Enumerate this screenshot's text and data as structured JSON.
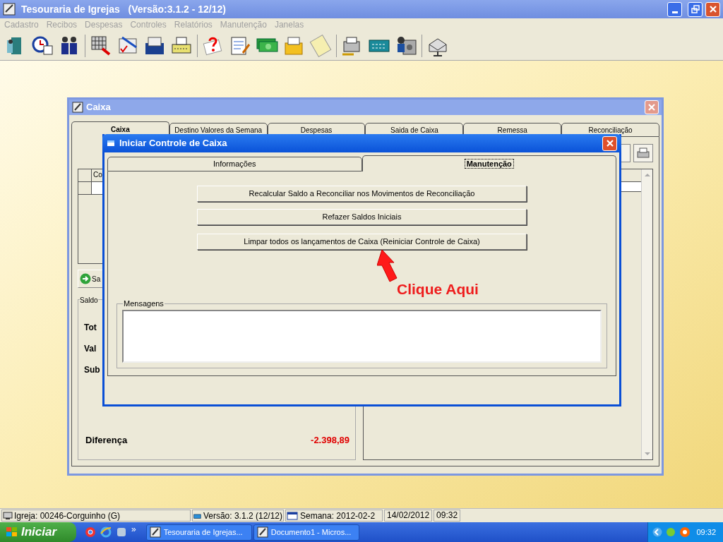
{
  "app_window": {
    "title": "Tesouraria de Igrejas   (Versão:3.1.2 - 12/12)"
  },
  "menu": [
    {
      "label": "Cadastro",
      "disabled": true
    },
    {
      "label": "Recibos",
      "disabled": true
    },
    {
      "label": "Despesas",
      "disabled": true
    },
    {
      "label": "Controles",
      "disabled": true
    },
    {
      "label": "Relatórios",
      "disabled": true
    },
    {
      "label": "Manutenção",
      "disabled": true
    },
    {
      "label": "Janelas",
      "disabled": true
    }
  ],
  "caixa_window": {
    "title": "Caixa",
    "tabs": [
      {
        "label": "Caixa",
        "selected": true
      },
      {
        "label": "Destino Valores da Semana",
        "selected": false
      },
      {
        "label": "Despesas",
        "selected": false
      },
      {
        "label": "Saida de Caixa",
        "selected": false
      },
      {
        "label": "Remessa",
        "selected": false
      },
      {
        "label": "Reconciliação",
        "selected": false
      }
    ],
    "table": {
      "columns": [
        "Co"
      ]
    },
    "button": "Sa",
    "saldo": {
      "label": "Saldo",
      "rows": [
        {
          "label": "Tot"
        },
        {
          "label": "Val"
        },
        {
          "label": "Sub"
        }
      ],
      "difference": {
        "label": "Diferença",
        "value": "-2.398,89"
      }
    }
  },
  "dialog": {
    "title": "Iniciar Controle de Caixa",
    "tabs": [
      {
        "label": "Informações",
        "selected": false
      },
      {
        "label": "Manutenção",
        "selected": true
      }
    ],
    "buttons": [
      "Recalcular Saldo a Reconciliar nos Movimentos de Reconciliação",
      "Refazer Saldos Iniciais",
      "Limpar todos os lançamentos de Caixa (Reiniciar Controle de Caixa)"
    ],
    "messages": {
      "label": "Mensagens"
    }
  },
  "annotation": {
    "text": "Clique Aqui"
  },
  "status_bar": {
    "church": "Igreja: 00246-Corguinho (G)",
    "version": "Versão: 3.1.2 (12/12)",
    "week": "Semana: 2012-02-2",
    "date": "14/02/2012",
    "time": "09:32"
  },
  "taskbar": {
    "start": "Iniciar",
    "more": "»",
    "tasks": [
      "Tesouraria de Igrejas...",
      "Documento1 - Micros..."
    ],
    "clock": "09:32"
  }
}
